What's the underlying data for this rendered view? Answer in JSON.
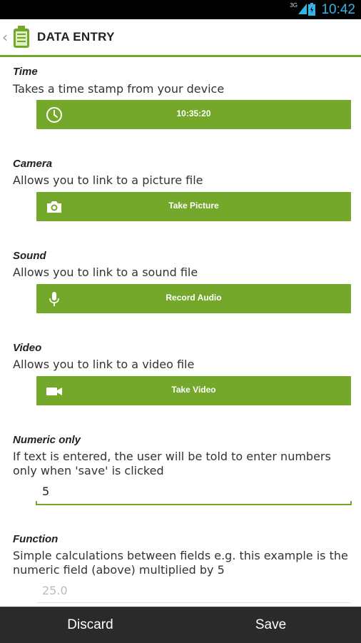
{
  "status_bar": {
    "time": "10:42",
    "network": "3G"
  },
  "action_bar": {
    "title": "DATA ENTRY"
  },
  "fields": [
    {
      "title": "Time",
      "description": "Takes a time stamp from your device",
      "button_label": "10:35:20",
      "icon": "clock-icon"
    },
    {
      "title": "Camera",
      "description": "Allows you to link to a picture file",
      "button_label": "Take Picture",
      "icon": "camera-icon"
    },
    {
      "title": "Sound",
      "description": "Allows you to link to a sound file",
      "button_label": "Record Audio",
      "icon": "microphone-icon"
    },
    {
      "title": "Video",
      "description": "Allows you to link to a video file",
      "button_label": "Take Video",
      "icon": "video-camera-icon"
    },
    {
      "title": "Numeric only",
      "description": "If text is entered, the user will be told to enter numbers only when 'save' is clicked",
      "value": "5"
    },
    {
      "title": "Function",
      "description": "Simple calculations between fields e.g. this example is the numeric field (above) multiplied by 5",
      "value": "25.0"
    }
  ],
  "bottom_bar": {
    "discard_label": "Discard",
    "save_label": "Save"
  },
  "colors": {
    "accent": "#74a82a",
    "status_text": "#33b5e5",
    "bottom_bar": "#2a2a2a"
  }
}
